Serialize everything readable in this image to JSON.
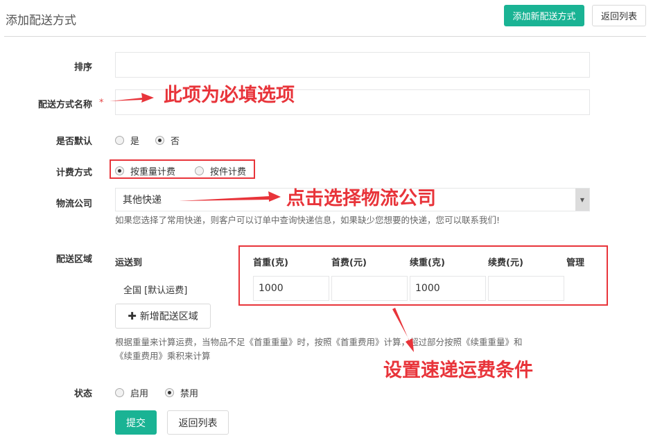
{
  "header": {
    "title": "添加配送方式",
    "add_button": "添加新配送方式",
    "back_button": "返回列表"
  },
  "form": {
    "sort_label": "排序",
    "sort_value": "",
    "name_label": "配送方式名称",
    "name_required": "*",
    "name_value": "",
    "default_label": "是否默认",
    "default_options": [
      "是",
      "否"
    ],
    "default_selected": "否",
    "billing_label": "计费方式",
    "billing_options": [
      "按重量计费",
      "按件计费"
    ],
    "billing_selected": "按重量计费",
    "logistics_label": "物流公司",
    "logistics_value": "其他快递",
    "logistics_help": "如果您选择了常用快递，则客户可以订单中查询快递信息，如果缺少您想要的快递，您可以联系我们!",
    "area_label": "配送区域",
    "area_table": {
      "headers": [
        "运送到",
        "首重(克)",
        "首费(元)",
        "续重(克)",
        "续费(元)",
        "管理"
      ],
      "rows": [
        {
          "destination": "全国 [默认运费]",
          "first_weight": "1000",
          "first_fee": "",
          "extra_weight": "1000",
          "extra_fee": ""
        }
      ]
    },
    "add_area_button": "新增配送区域",
    "area_help_line1": "根据重量来计算运费，当物品不足《首重重量》时，按照《首重费用》计算，超过部分按照《续重重量》和",
    "area_help_line2": "《续重费用》乘积来计算",
    "status_label": "状态",
    "status_options": [
      "启用",
      "禁用"
    ],
    "status_selected": "禁用",
    "submit_button": "提交",
    "back_button": "返回列表"
  },
  "annotations": {
    "required_note": "此项为必填选项",
    "logistics_note": "点击选择物流公司",
    "fee_note": "设置速递运费条件"
  },
  "colors": {
    "primary": "#1ab394",
    "annotation": "#e8343a"
  }
}
